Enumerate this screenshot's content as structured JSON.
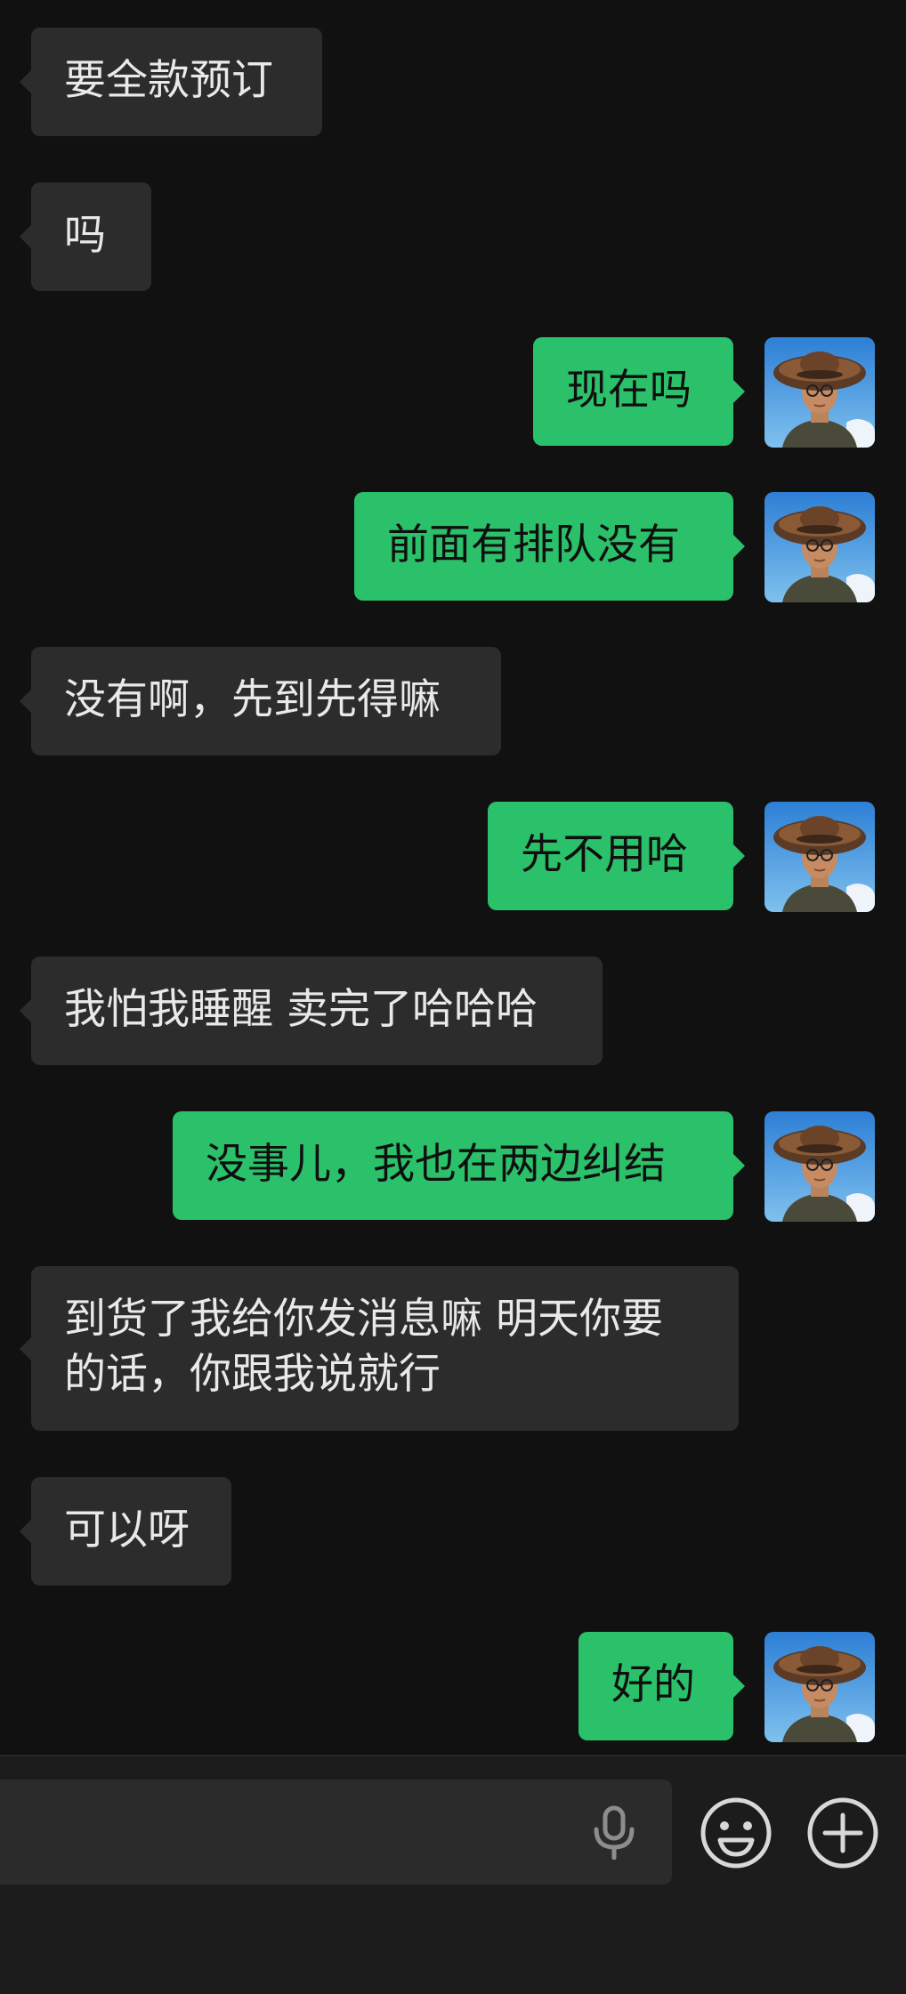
{
  "conversation": {
    "messages": [
      {
        "side": "in",
        "text": "要全款预订"
      },
      {
        "side": "in",
        "text": "吗"
      },
      {
        "side": "out",
        "text": "现在吗"
      },
      {
        "side": "out",
        "text": "前面有排队没有"
      },
      {
        "side": "in",
        "text": "没有啊，先到先得嘛"
      },
      {
        "side": "out",
        "text": "先不用哈"
      },
      {
        "side": "in",
        "text": "我怕我睡醒 卖完了哈哈哈"
      },
      {
        "side": "out",
        "text": "没事儿，我也在两边纠结"
      },
      {
        "side": "in",
        "text": "到货了我给你发消息嘛 明天你要\n的话，你跟我说就行"
      },
      {
        "side": "in",
        "text": "可以呀"
      },
      {
        "side": "out",
        "text": "好的"
      }
    ]
  },
  "colors": {
    "background": "#111111",
    "incoming_bubble": "#2c2c2c",
    "outgoing_bubble": "#2bc16a",
    "input_bar": "#1c1c1c"
  },
  "icons": {
    "mic": "microphone-icon",
    "emoji": "smiley-icon",
    "plus": "plus-circle-icon"
  }
}
